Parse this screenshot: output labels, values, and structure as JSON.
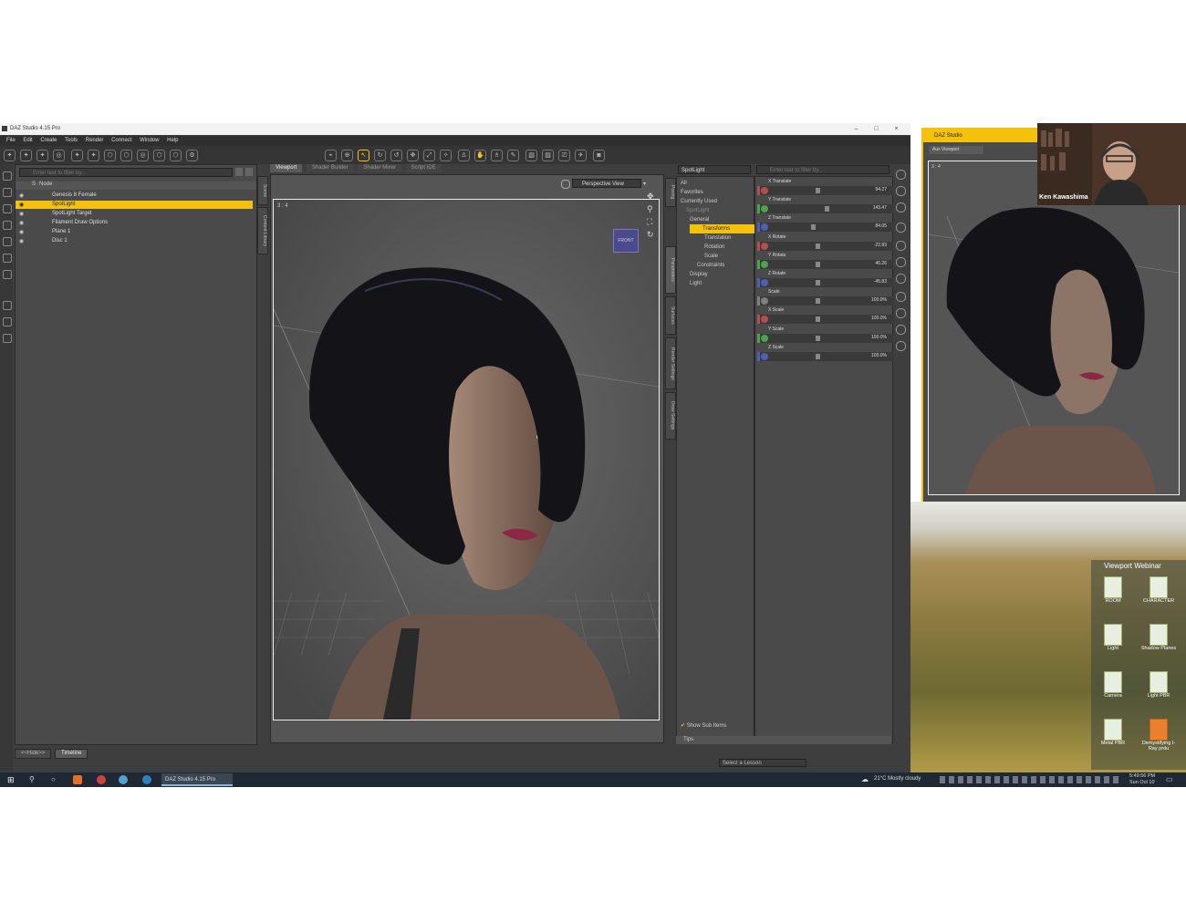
{
  "window": {
    "title": "DAZ Studio 4.15 Pro"
  },
  "menu": [
    "File",
    "Edit",
    "Create",
    "Tools",
    "Render",
    "Connect",
    "Window",
    "Help"
  ],
  "scene": {
    "filter_placeholder": "Enter text to filter by...",
    "header_col": "S",
    "header_node": "Node",
    "nodes": [
      "Genesis 8 Female",
      "SpotLight",
      "SpotLight Target",
      "Filament Draw Options",
      "Plane 1",
      "Disc 1"
    ],
    "selected": "SpotLight",
    "tabs": [
      "<<Hide>>",
      "Timeline"
    ],
    "side_tabs": [
      "Scene",
      "Content Library"
    ]
  },
  "viewport": {
    "tabs": [
      "Viewport",
      "Shader Builder",
      "Shader Mixer",
      "Script IDE"
    ],
    "active_tab": "Viewport",
    "view_select": "Perspective View",
    "ratio_label": "3 : 4",
    "cube_label": "FRONT"
  },
  "parameters": {
    "node_select": "SpotLight",
    "filter_placeholder": "Enter text to filter by...",
    "categories": [
      "All",
      "Favorites",
      "Currently Used",
      "SpotLight",
      "General",
      "Transforms",
      "Translation",
      "Rotation",
      "Scale",
      "Constraints",
      "Display",
      "Light"
    ],
    "selected_category": "Transforms",
    "side_tabs": [
      "Posing",
      "Parameters",
      "Surfaces",
      "Render Settings",
      "Draw Settings"
    ],
    "sliders": [
      {
        "name": "X Translate",
        "value": "94.27",
        "color": "#b05050"
      },
      {
        "name": "Y Translate",
        "value": "143.47",
        "color": "#50a050"
      },
      {
        "name": "Z Translate",
        "value": "84.05",
        "color": "#5060b0"
      },
      {
        "name": "X Rotate",
        "value": "-22.83",
        "color": "#b05050"
      },
      {
        "name": "Y Rotate",
        "value": "40.26",
        "color": "#50a050"
      },
      {
        "name": "Z Rotate",
        "value": "-45.83",
        "color": "#5060b0"
      },
      {
        "name": "Scale",
        "value": "100.0%",
        "color": "#808080"
      },
      {
        "name": "X Scale",
        "value": "100.0%",
        "color": "#b05050"
      },
      {
        "name": "Y Scale",
        "value": "100.0%",
        "color": "#50a050"
      },
      {
        "name": "Z Scale",
        "value": "100.0%",
        "color": "#5060b0"
      }
    ],
    "show_sub_items": "Show Sub Items",
    "tips": "Tips",
    "lesson_select": "Select a Lesson"
  },
  "aux": {
    "title": "DAZ Studio",
    "tab": "Aux Viewport",
    "ratio_label": "3 : 4"
  },
  "webcam": {
    "name": "Ken Kawashima"
  },
  "desktop": {
    "folder_title": "Viewport Webinar",
    "icons": [
      "ROOM",
      "CHARACTER",
      "Light",
      "Shadow Planes",
      "Camera",
      "Light PBR",
      "Metal PBR",
      "Demystifying I-Ray prdu"
    ]
  },
  "taskbar": {
    "active_app": "DAZ Studio 4.15 Pro",
    "weather": "21°C  Mostly cloudy",
    "time": "5:49:56 PM",
    "date": "Sun Oct 10"
  },
  "colors": {
    "accent": "#f4c20d",
    "panel": "#4a4a4a",
    "taskbar": "#1f2933"
  }
}
